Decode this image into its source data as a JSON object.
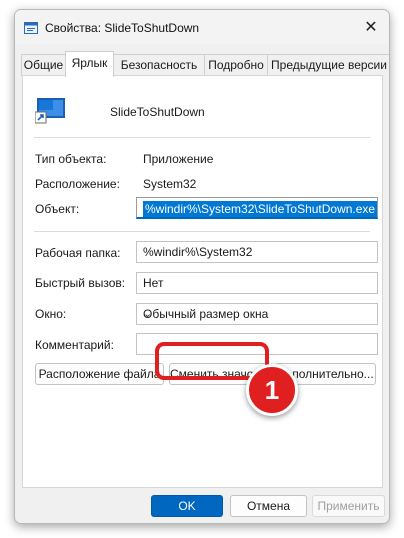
{
  "window": {
    "title": "Свойства: SlideToShutDown",
    "close_label": "✕",
    "app_icon": "properties-icon"
  },
  "tabs": [
    {
      "label": "Общие"
    },
    {
      "label": "Ярлык",
      "active": true
    },
    {
      "label": "Безопасность"
    },
    {
      "label": "Подробно"
    },
    {
      "label": "Предыдущие версии"
    }
  ],
  "shortcut": {
    "name": "SlideToShutDown",
    "icon": "shortcut-app-icon"
  },
  "info": {
    "type_label": "Тип объекта:",
    "type_value": "Приложение",
    "location_label": "Расположение:",
    "location_value": "System32",
    "target_label": "Объект:",
    "target_value": "%windir%\\System32\\SlideToShutDown.exe"
  },
  "fields": {
    "start_in_label": "Рабочая папка:",
    "start_in_value": "%windir%\\System32",
    "hotkey_label": "Быстрый вызов:",
    "hotkey_value": "Нет",
    "run_label": "Окно:",
    "run_value": "Обычный размер окна",
    "comment_label": "Комментарий:",
    "comment_value": ""
  },
  "buttons": {
    "open_location": "Расположение файла",
    "change_icon": "Сменить значок...",
    "advanced": "Дополнительно...",
    "ok": "OK",
    "cancel": "Отмена",
    "apply": "Применить"
  },
  "annotation": {
    "marker_number": "1",
    "color": "#e02020"
  },
  "colors": {
    "accent": "#0067c0",
    "selection": "#0078d4"
  }
}
